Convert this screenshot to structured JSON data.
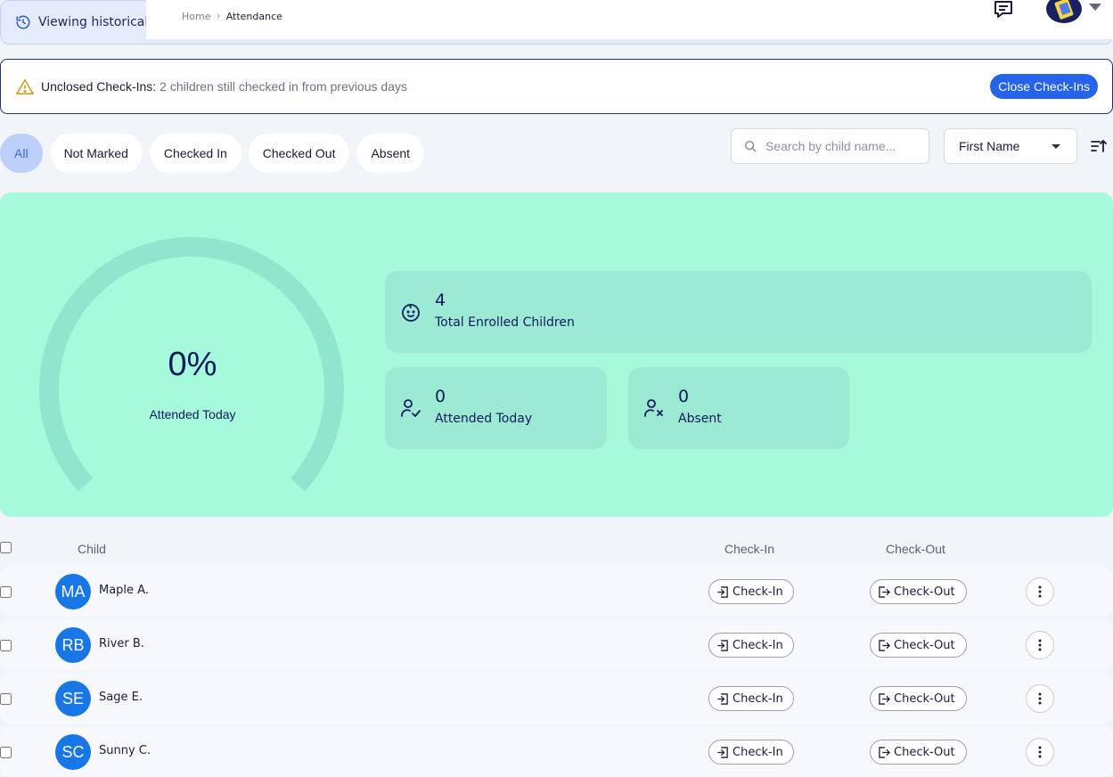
{
  "banner": {
    "text": "Viewing historical c"
  },
  "breadcrumb": {
    "home": "Home",
    "current": "Attendance"
  },
  "header": {
    "chat_icon": "chat-bubble-icon",
    "avatar_icon": "user-avatar-icon"
  },
  "alert": {
    "title": "Unclosed Check-Ins:",
    "message": "2 children still checked in from previous days",
    "button": "Close Check-Ins",
    "icon": "warning-icon"
  },
  "filters": {
    "tabs": [
      {
        "label": "All",
        "active": true
      },
      {
        "label": "Not Marked"
      },
      {
        "label": "Checked In"
      },
      {
        "label": "Checked Out"
      },
      {
        "label": "Absent"
      }
    ]
  },
  "search": {
    "placeholder": "Search by child name..."
  },
  "sort": {
    "value": "First Name"
  },
  "summary": {
    "gauge": {
      "value": "0%",
      "label": "Attended Today",
      "fraction": 0
    },
    "total": {
      "value": "4",
      "label": "Total Enrolled Children"
    },
    "attended": {
      "value": "0",
      "label": "Attended Today"
    },
    "absent": {
      "value": "0",
      "label": "Absent"
    }
  },
  "table": {
    "headers": {
      "child": "Child",
      "check_in": "Check-In",
      "check_out": "Check-Out"
    },
    "rows": [
      {
        "initials": "MA",
        "name": "Maple A.",
        "check_in": "Check-In",
        "check_out": "Check-Out"
      },
      {
        "initials": "RB",
        "name": "River B.",
        "check_in": "Check-In",
        "check_out": "Check-Out"
      },
      {
        "initials": "SE",
        "name": "Sage E.",
        "check_in": "Check-In",
        "check_out": "Check-Out"
      },
      {
        "initials": "SC",
        "name": "Sunny C.",
        "check_in": "Check-In",
        "check_out": "Check-Out"
      }
    ]
  },
  "colors": {
    "accent": "#2563eb",
    "summary_bg": "#a7f9dc",
    "stat_bg": "#9ce9d4",
    "avatar": "#1976e6"
  }
}
